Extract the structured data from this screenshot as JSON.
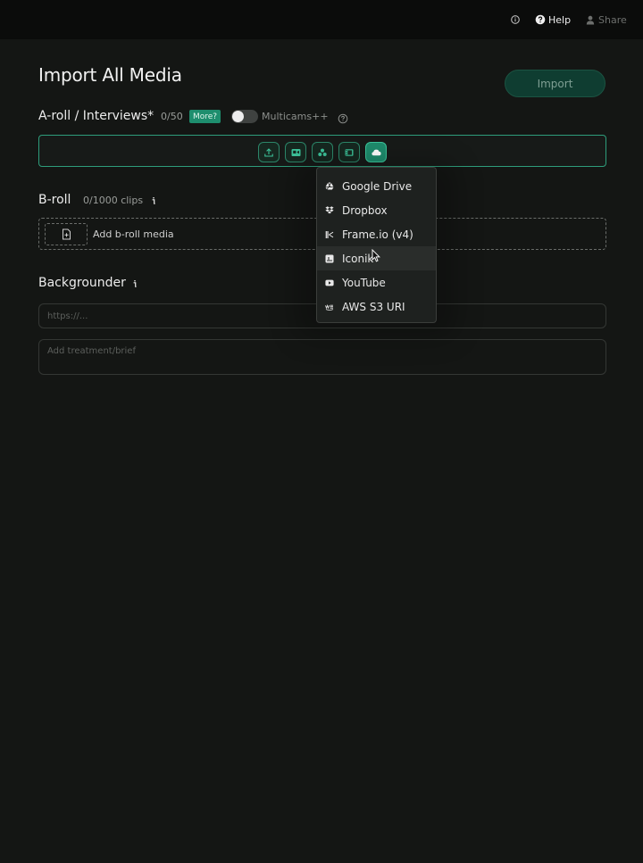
{
  "topbar": {
    "info_icon": "info-icon",
    "help_label": "Help",
    "share_label": "Share"
  },
  "header": {
    "title": "Import All Media",
    "import_label": "Import"
  },
  "aroll": {
    "title": "A-roll / Interviews*",
    "count": "0/50",
    "more_label": "More?",
    "multicam_label": "Multicams++",
    "sources": [
      {
        "icon": "upload-icon"
      },
      {
        "icon": "video-record-icon"
      },
      {
        "icon": "people-icon"
      },
      {
        "icon": "film-icon"
      },
      {
        "icon": "cloud-icon"
      }
    ]
  },
  "cloud_menu": {
    "items": [
      {
        "label": "Google Drive",
        "icon": "google-drive-icon"
      },
      {
        "label": "Dropbox",
        "icon": "dropbox-icon"
      },
      {
        "label": "Frame.io (v4)",
        "icon": "frameio-icon"
      },
      {
        "label": "Iconik",
        "icon": "iconik-icon"
      },
      {
        "label": "YouTube",
        "icon": "youtube-icon"
      },
      {
        "label": "AWS S3 URI",
        "icon": "aws-icon"
      }
    ]
  },
  "broll": {
    "title": "B-roll",
    "count": "0/1000 clips",
    "add_label": "Add b-roll media"
  },
  "backgrounder": {
    "title": "Backgrounder",
    "url_placeholder": "https://...",
    "brief_placeholder": "Add treatment/brief"
  },
  "colors": {
    "background": "#141614",
    "accent": "#1e8e6e",
    "import_button": "#0f3d31"
  }
}
